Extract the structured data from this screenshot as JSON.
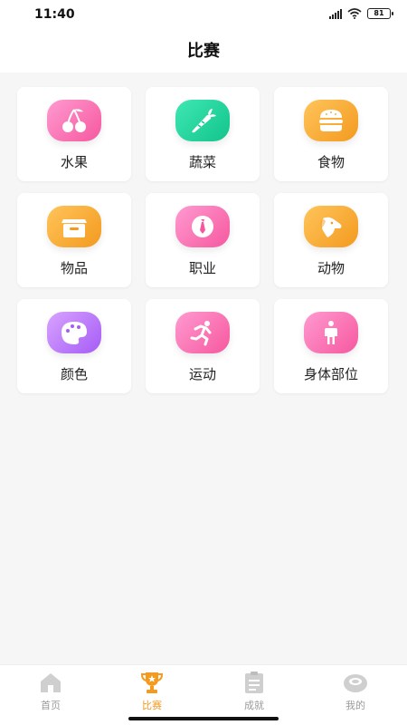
{
  "status": {
    "time": "11:40",
    "battery": "81"
  },
  "header": {
    "title": "比赛"
  },
  "categories": [
    {
      "label": "水果",
      "icon": "cherry-icon",
      "color": "pink"
    },
    {
      "label": "蔬菜",
      "icon": "carrot-icon",
      "color": "green"
    },
    {
      "label": "食物",
      "icon": "burger-icon",
      "color": "orange"
    },
    {
      "label": "物品",
      "icon": "box-icon",
      "color": "orange"
    },
    {
      "label": "职业",
      "icon": "tie-icon",
      "color": "pink"
    },
    {
      "label": "动物",
      "icon": "dog-icon",
      "color": "orange"
    },
    {
      "label": "颜色",
      "icon": "palette-icon",
      "color": "purple"
    },
    {
      "label": "运动",
      "icon": "runner-icon",
      "color": "pink"
    },
    {
      "label": "身体部位",
      "icon": "person-icon",
      "color": "pink"
    }
  ],
  "tabs": [
    {
      "label": "首页",
      "icon": "home-icon",
      "active": false
    },
    {
      "label": "比赛",
      "icon": "trophy-icon",
      "active": true
    },
    {
      "label": "成就",
      "icon": "clipboard-icon",
      "active": false
    },
    {
      "label": "我的",
      "icon": "profile-icon",
      "active": false
    }
  ],
  "colors": {
    "accent": "#f39a1f",
    "pink": "#f6589f",
    "green": "#12c48b",
    "purple": "#a55cf6"
  }
}
